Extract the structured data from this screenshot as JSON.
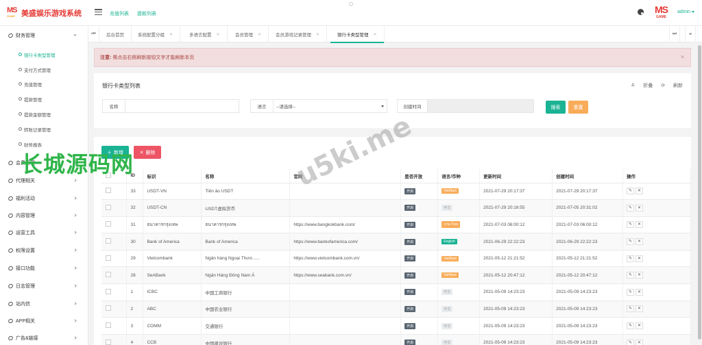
{
  "header": {
    "app_title": "美盛娱乐游戏系统",
    "logo_mark": "MS",
    "logo_sub": "GAME",
    "links": [
      "充值列表",
      "提款列表"
    ],
    "user": "admin"
  },
  "sidebar": {
    "groups_top": [
      {
        "label": "财务管理"
      }
    ],
    "sub_items": [
      {
        "label": "银行卡类型管理",
        "active": true
      },
      {
        "label": "支付方式管理"
      },
      {
        "label": "充值管理"
      },
      {
        "label": "提款管理"
      },
      {
        "label": "提款金额管理"
      },
      {
        "label": "转账记录管理"
      },
      {
        "label": "财务报表"
      }
    ],
    "groups": [
      {
        "label": "会员管理"
      },
      {
        "label": "代理相关"
      },
      {
        "label": "福利活动"
      },
      {
        "label": "内容管理"
      },
      {
        "label": "运营工具"
      },
      {
        "label": "权限设置"
      },
      {
        "label": "接口功能"
      },
      {
        "label": "日志管理"
      },
      {
        "label": "站内信"
      },
      {
        "label": "APP相关"
      },
      {
        "label": "广告&链接"
      }
    ]
  },
  "tabs": {
    "prev": "⏮",
    "next": "⏭",
    "menu": "≡",
    "items": [
      {
        "label": "后台首页"
      },
      {
        "label": "系统配置分组"
      },
      {
        "label": "多语言配置"
      },
      {
        "label": "会员管理"
      },
      {
        "label": "会员游戏记录管理"
      },
      {
        "label": "银行卡类型管理",
        "active": true
      }
    ]
  },
  "alert": {
    "prefix": "注意:",
    "text": "需点击右侧刷新按钮文字才能刷新本页"
  },
  "search_panel": {
    "title": "银行卡类型列表",
    "fold_label": "折叠",
    "refresh_label": "刷新",
    "name_label": "名称",
    "name_value": "",
    "lang_label": "语言",
    "lang_value": "--请选择--",
    "created_label": "创建时间",
    "created_value": "",
    "search_button": "搜索",
    "reset_button": "重置"
  },
  "toolbar": {
    "add_label": "新增",
    "delete_label": "删除"
  },
  "table": {
    "columns": [
      "ID",
      "标识",
      "名称",
      "官网",
      "是否开放",
      "语言/币种",
      "更新时间",
      "创建时间",
      "操作"
    ],
    "rows": [
      {
        "id": "33",
        "code": "USDT-VN",
        "name": "Tiền ảo USDT",
        "site": "",
        "open": "开启",
        "lang": "VietNam",
        "lang_color": "orange",
        "updated": "2021-07-29 20:17:37",
        "created": "2021-07-29 20:17:37"
      },
      {
        "id": "32",
        "code": "USDT-CN",
        "name": "USDT虚拟货币",
        "site": "",
        "open": "开启",
        "lang": "中文",
        "lang_color": "light",
        "updated": "2021-07-29 20:16:55",
        "created": "2021-07-05 20:31:02"
      },
      {
        "id": "31",
        "code": "ธนาคารกรุงเทพ",
        "name": "ธนาคารกรุงเทพ",
        "site": "https://www.bangkokbank.com/",
        "open": "开启",
        "lang": "ภาษาไทย",
        "lang_color": "orange",
        "updated": "2021-07-03 06:00:12",
        "created": "2021-07-03 06:00:12"
      },
      {
        "id": "30",
        "code": "Bank of America",
        "name": "Bank of America",
        "site": "https://www.bankofamerica.com/",
        "open": "开启",
        "lang": "English",
        "lang_color": "green",
        "updated": "2021-06-29 22:22:23",
        "created": "2021-06-29 22:22:23"
      },
      {
        "id": "29",
        "code": "Vietcombank",
        "name": "Ngân hàng Ngoại Thươ......",
        "site": "https://www.vietcombank.com.vn/",
        "open": "开启",
        "lang": "VietNam",
        "lang_color": "orange",
        "updated": "2021-05-12 21:21:52",
        "created": "2021-05-12 21:21:52"
      },
      {
        "id": "28",
        "code": "SeABank",
        "name": "Ngân Hàng Đông Nam Á",
        "site": "https://www.seabank.com.vn/",
        "open": "开启",
        "lang": "VietNam",
        "lang_color": "orange",
        "updated": "2021-05-12 20:47:12",
        "created": "2021-05-12 20:47:12"
      },
      {
        "id": "1",
        "code": "ICBC",
        "name": "中国工商银行",
        "site": "",
        "open": "开启",
        "lang": "中文",
        "lang_color": "light",
        "updated": "2021-05-09 14:23:23",
        "created": "2021-05-09 14:23:23"
      },
      {
        "id": "2",
        "code": "ABC",
        "name": "中国农业银行",
        "site": "",
        "open": "开启",
        "lang": "中文",
        "lang_color": "light",
        "updated": "2021-05-09 14:23:23",
        "created": "2021-05-09 14:23:23"
      },
      {
        "id": "3",
        "code": "COMM",
        "name": "交通银行",
        "site": "",
        "open": "开启",
        "lang": "中文",
        "lang_color": "light",
        "updated": "2021-05-09 14:23:23",
        "created": "2021-05-09 14:23:23"
      },
      {
        "id": "4",
        "code": "CCB",
        "name": "中国建设银行",
        "site": "",
        "open": "开启",
        "lang": "中文",
        "lang_color": "light",
        "updated": "2021-05-09 14:23:23",
        "created": "2021-05-09 14:23:23"
      }
    ],
    "edit_icon": "pencil-icon",
    "delete_icon": "close-icon"
  },
  "watermarks": {
    "green_text": "长城源码网",
    "gray_text": "u5ki.me"
  },
  "colors": {
    "accent": "#1ab394",
    "danger": "#ed5565",
    "warning": "#f8ac59",
    "brand": "#e53935"
  }
}
